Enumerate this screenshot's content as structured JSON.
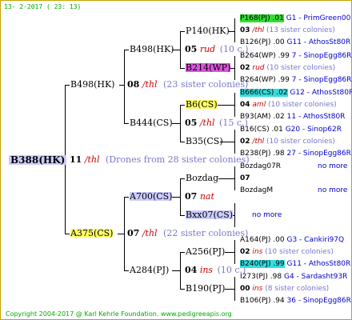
{
  "header": "13-  2-2017  ( 23: 13)",
  "footer": "Copyright 2004-2017 @ Karl Kehrle Foundation.   www.pedigreeapis.org",
  "root": {
    "id": "B388(HK)",
    "gen": "11",
    "label": "/thl",
    "desc": "(Drones from 28 sister colonies)"
  },
  "gen2": [
    {
      "id": "B498(HK)",
      "gen": "08",
      "label": "/thl",
      "desc": "(23 sister colonies)"
    },
    {
      "id": "A375(CS)",
      "gen": "07",
      "label": "/thl",
      "desc": "(22 sister colonies)"
    }
  ],
  "gen3": [
    {
      "id": "B498(HK)",
      "gen": "05",
      "label": "rud",
      "desc": "(10 c.)"
    },
    {
      "id": "B444(CS)",
      "gen": "05",
      "label": "/thl",
      "desc": "(15 c.)"
    },
    {
      "id": "A700(CS)",
      "gen": "07",
      "label": "nat",
      "desc": ""
    },
    {
      "id": "A284(PJ)",
      "gen": "04",
      "label": "ins",
      "desc": "(10 c.)"
    }
  ],
  "gen4": [
    "P140(HK)",
    "B214(WP)",
    "B6(CS)",
    "B35(CS)",
    "Bozdag",
    "Bxx07(CS)",
    "A256(PJ)",
    "B190(PJ)"
  ],
  "gen5": [
    {
      "top": "P168(PJ) .01",
      "top_line": "G1 - PrimGreen00",
      "num": "03",
      "label": "/thl",
      "desc": "(13 sister colonies)",
      "bottom": "B126(PJ) .00",
      "bottom_line": "G11 - AthosSt80R"
    },
    {
      "top": "B264(WP) .99",
      "top_line": "7 - SinopEgg86R",
      "num": "02",
      "label": "rud",
      "desc": "(10 sister colonies)",
      "bottom": "B264(WP) .99",
      "bottom_line": "7 - SinopEgg86R"
    },
    {
      "top": "B666(CS) .02",
      "top_line": "G12 - AthosSt80R",
      "num": "04",
      "label": "aml",
      "desc": "(10 sister colonies)",
      "bottom": "B93(AM) .02",
      "bottom_line": "11 - AthosSt80R"
    },
    {
      "top": "B16(CS) .01",
      "top_line": "G20 - Sinop62R",
      "num": "02",
      "label": "/thl",
      "desc": "(10 sister colonies)",
      "bottom": "B238(PJ) .98",
      "bottom_line": "27 - SinopEgg86R"
    },
    {
      "top": "Bozdag07R",
      "top_line": "no more",
      "num": "07",
      "label": "",
      "desc": "",
      "bottom": "BozdagM",
      "bottom_line": "no more"
    },
    {
      "top": "",
      "top_line": "no more",
      "num": "",
      "label": "",
      "desc": "",
      "bottom": "",
      "bottom_line": ""
    },
    {
      "top": "A164(PJ) .00",
      "top_line": "G3 - Cankiri97Q",
      "num": "02",
      "label": "ins",
      "desc": "(10 sister colonies)",
      "bottom": "B240(PJ) .99",
      "bottom_line": "G11 - AthosSt80R"
    },
    {
      "top": "I273(PJ) .98",
      "top_line": "G4 - Sardasht93R",
      "num": "00",
      "label": "ins",
      "desc": "(8 sister colonies)",
      "bottom": "B106(PJ) .94",
      "bottom_line": "36 - SinopEgg86R"
    }
  ],
  "colors": {
    "border": "#c8a000",
    "highlight_yellow": "#ffff66",
    "highlight_green": "#33dd33",
    "highlight_cyan": "#33dddd",
    "highlight_magenta": "#dd55dd",
    "highlight_lavender": "#ccccff",
    "label_red": "#cc0000",
    "desc_blue": "#7777cc",
    "footer_green": "#00aa00"
  }
}
